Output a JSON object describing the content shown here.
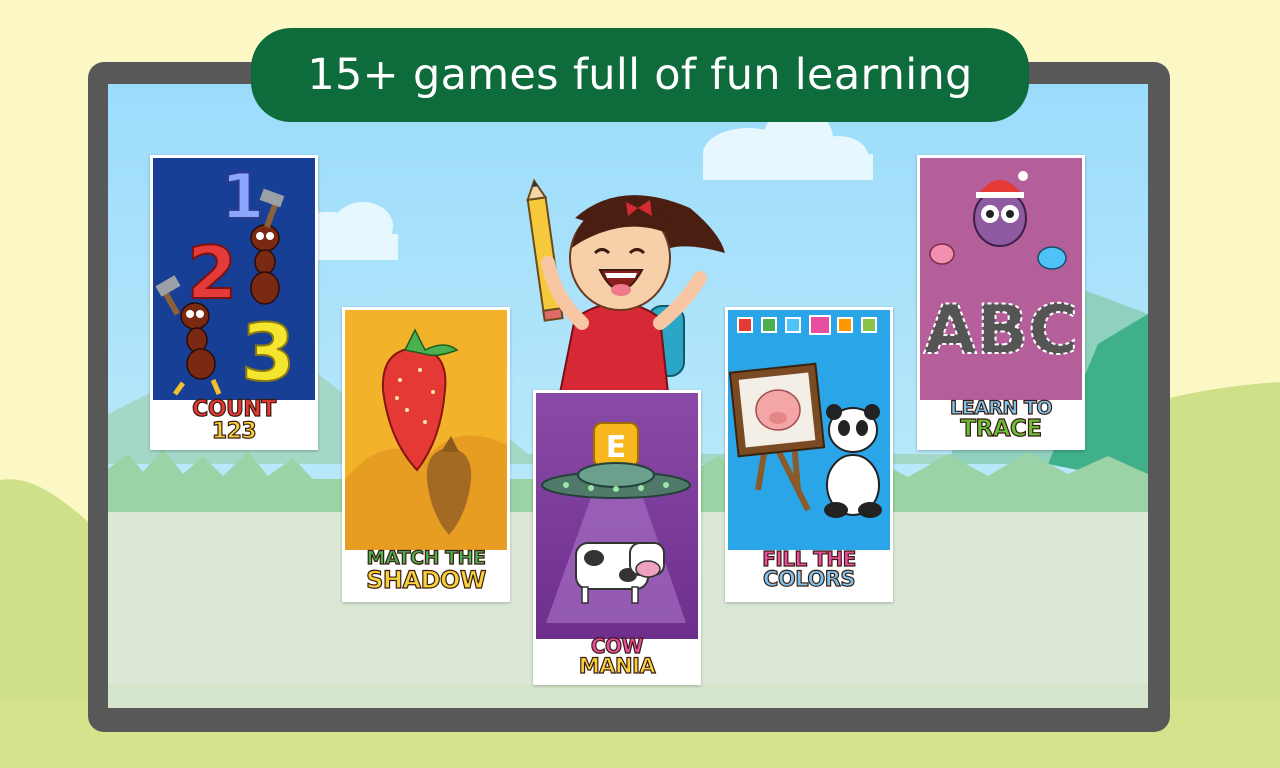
{
  "banner": {
    "title": "15+ games full of fun learning"
  },
  "cards": [
    {
      "id": "count",
      "line1": "COUNT",
      "line2": "123",
      "icon": "ants-numbers-art"
    },
    {
      "id": "shadow",
      "line1": "MATCH THE",
      "line2": "SHADOW",
      "icon": "strawberry-shadow-art"
    },
    {
      "id": "cow",
      "line1": "COW",
      "line2": "MANIA",
      "icon": "ufo-cow-art",
      "badge": "E"
    },
    {
      "id": "colors",
      "line1": "FILL THE",
      "line2": "COLORS",
      "icon": "panda-easel-art"
    },
    {
      "id": "trace",
      "line1": "LEARN TO",
      "line2": "TRACE",
      "icon": "owl-abc-art",
      "letters": "ABC"
    }
  ],
  "count_numbers": [
    "1",
    "2",
    "3"
  ],
  "colors": {
    "banner": "#0d6b3c",
    "tablet_frame": "#585858",
    "sky": "#9cdcfb",
    "grass": "#cfe7c0",
    "hill_back": "#cfe08a"
  }
}
